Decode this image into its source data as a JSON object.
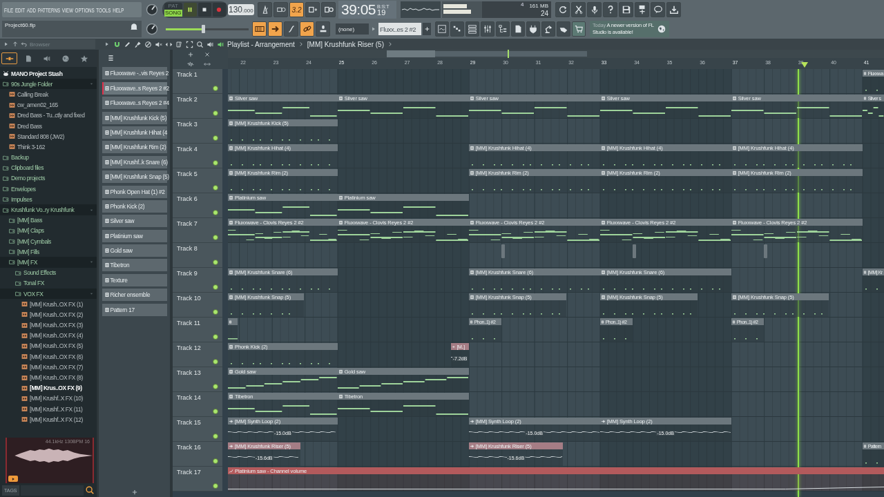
{
  "menu": [
    "FILE",
    "EDIT",
    "ADD",
    "PATTERNS",
    "VIEW",
    "OPTIONS",
    "TOOLS",
    "HELP"
  ],
  "project": {
    "file": "Project60.flp"
  },
  "transport": {
    "pat_label": "PAT",
    "song_label": "SONG",
    "song_selected": true,
    "playing": true,
    "tempo": "130",
    "tempo_decimals": ".000"
  },
  "mode_buttons": [
    {
      "on": false
    },
    {
      "on": false
    },
    {
      "label": "3.2",
      "on": true
    },
    {
      "on": false
    },
    {
      "on": false
    }
  ],
  "time": {
    "main": "39:05",
    "ticks": "19",
    "format": "B:S:T"
  },
  "monitor": {
    "cpu": "4",
    "memory": "161 MB",
    "polyphony": "24"
  },
  "master_volume": {
    "level": 0.45
  },
  "record_buttons": [
    {
      "on": true
    },
    {
      "on": true
    },
    {
      "on": false
    },
    {
      "on": true
    },
    {
      "on": false
    }
  ],
  "pattern_picker": {
    "snap": "(none)",
    "pattern": "Fluxx..es 2 #2"
  },
  "news": {
    "date": "Today",
    "text": "A newer version of FL Studio is available!"
  },
  "browser": {
    "title": "Browser",
    "tabs": [
      {
        "selected": true
      },
      {
        "selected": false
      },
      {
        "selected": false
      },
      {
        "selected": false
      },
      {
        "selected": false
      }
    ],
    "tree": [
      {
        "label": "MANO Project Stash",
        "kind": "pack",
        "selected": false
      },
      {
        "label": "90s Jungle Folder",
        "kind": "folder",
        "expanded": true,
        "selected": false,
        "children": [
          {
            "label": "Calling Break",
            "kind": "file",
            "selected": false
          },
          {
            "label": "cw_amen02_165",
            "kind": "file",
            "selected": false
          },
          {
            "label": "Dred Bass - Tu..ctly and fixed",
            "kind": "file",
            "selected": false
          },
          {
            "label": "Dred Bass",
            "kind": "file",
            "selected": false
          },
          {
            "label": "Standard 808 (JW2)",
            "kind": "file",
            "selected": false
          },
          {
            "label": "Think 3-162",
            "kind": "file",
            "selected": false
          }
        ]
      },
      {
        "label": "Backup",
        "kind": "folder",
        "expanded": false,
        "selected": false
      },
      {
        "label": "Clipboard files",
        "kind": "folder",
        "expanded": false,
        "selected": false
      },
      {
        "label": "Demo projects",
        "kind": "folder",
        "expanded": false,
        "selected": false
      },
      {
        "label": "Envelopes",
        "kind": "folder",
        "expanded": false,
        "selected": false
      },
      {
        "label": "Impulses",
        "kind": "folder",
        "expanded": false,
        "selected": false
      },
      {
        "label": "Krushfunk Vo..ry Krushfunk",
        "kind": "folder",
        "expanded": true,
        "selected": false,
        "children": [
          {
            "label": "[MM] Bass",
            "kind": "folder",
            "expanded": false,
            "selected": false
          },
          {
            "label": "[MM] Claps",
            "kind": "folder",
            "expanded": false,
            "selected": false
          },
          {
            "label": "[MM] Cymbals",
            "kind": "folder",
            "expanded": false,
            "selected": false
          },
          {
            "label": "[MM] Fills",
            "kind": "folder",
            "expanded": false,
            "selected": false
          },
          {
            "label": "[MM] FX",
            "kind": "folder",
            "expanded": true,
            "selected": false,
            "children": [
              {
                "label": "Sound Effects",
                "kind": "folder",
                "expanded": false,
                "selected": false
              },
              {
                "label": "Tonal FX",
                "kind": "folder",
                "expanded": false,
                "selected": false
              },
              {
                "label": "VOX FX",
                "kind": "folder",
                "expanded": true,
                "selected": false,
                "children": [
                  {
                    "label": "[MM] Krush..OX FX (1)",
                    "kind": "file",
                    "selected": false
                  },
                  {
                    "label": "[MM] Krush..OX FX (2)",
                    "kind": "file",
                    "selected": false
                  },
                  {
                    "label": "[MM] Krush..OX FX (3)",
                    "kind": "file",
                    "selected": false
                  },
                  {
                    "label": "[MM] Krush..OX FX (4)",
                    "kind": "file",
                    "selected": false
                  },
                  {
                    "label": "[MM] Krush..OX FX (5)",
                    "kind": "file",
                    "selected": false
                  },
                  {
                    "label": "[MM] Krush..OX FX (6)",
                    "kind": "file",
                    "selected": false
                  },
                  {
                    "label": "[MM] Krush..OX FX (7)",
                    "kind": "file",
                    "selected": false
                  },
                  {
                    "label": "[MM] Krush..OX FX (8)",
                    "kind": "file",
                    "selected": false
                  },
                  {
                    "label": "[MM] Krus..OX FX (9)",
                    "kind": "file",
                    "selected": true
                  },
                  {
                    "label": "[MM] Krushf..X FX (10)",
                    "kind": "file",
                    "selected": false
                  },
                  {
                    "label": "[MM] Krushf..X FX (11)",
                    "kind": "file",
                    "selected": false
                  },
                  {
                    "label": "[MM] Krushf..X FX (12)",
                    "kind": "file",
                    "selected": false
                  }
                ]
              }
            ]
          }
        ]
      }
    ],
    "preview": {
      "info": "44.1kHz 130BPM 16"
    },
    "tags_label": "TAGS"
  },
  "patterns": [
    {
      "label": "Fluxxwave -..vis Reyes 2",
      "selected": false
    },
    {
      "label": "Fluxxwave..s Reyes 2 #2",
      "selected": true
    },
    {
      "label": "Fluxxwave..s Reyes 2 #4",
      "selected": false
    },
    {
      "label": "[MM] Krushfunk Kick (5)",
      "selected": false
    },
    {
      "label": "[MM] Krushfunk Hihat (4",
      "selected": false
    },
    {
      "label": "[MM] Krushfunk Rim (2)",
      "selected": false
    },
    {
      "label": "[MM] Krushf..k Snare (6)",
      "selected": false
    },
    {
      "label": "[MM] Krushfunk Snap (5)",
      "selected": false
    },
    {
      "label": "Phonk Open Hat (1) #2",
      "selected": false
    },
    {
      "label": "Phonk Kick (2)",
      "selected": false
    },
    {
      "label": "Silver saw",
      "selected": false
    },
    {
      "label": "Platinium saw",
      "selected": false
    },
    {
      "label": "Gold saw",
      "selected": false
    },
    {
      "label": "Tibetron",
      "selected": false
    },
    {
      "label": "Texture",
      "selected": false
    },
    {
      "label": "Richer ensemble",
      "selected": false
    },
    {
      "label": "Pattern 17",
      "selected": false
    }
  ],
  "playlist": {
    "title": "Playlist - Arrangement",
    "pattern": "[MM] Krushfunk Riser (5)",
    "bars": [
      "22",
      "23",
      "24",
      "25",
      "26",
      "27",
      "28",
      "29",
      "30",
      "31",
      "32",
      "33",
      "34",
      "35",
      "36",
      "37",
      "38",
      "39",
      "40",
      "41"
    ],
    "tracks": [
      {
        "name": "Track 1",
        "enabled": true,
        "clips": [
          {
            "kind": "pattern",
            "label": "Fluxxwa",
            "color": "#6c777d"
          }
        ]
      },
      {
        "name": "Track 2",
        "enabled": true,
        "clips": [
          {
            "kind": "pattern",
            "label": "Silver saw",
            "color": "#6c777d"
          },
          {
            "kind": "pattern",
            "label": "Silver saw",
            "color": "#6c777d"
          },
          {
            "kind": "pattern",
            "label": "Silver saw",
            "color": "#6c777d"
          },
          {
            "kind": "pattern",
            "label": "Silver saw",
            "color": "#6c777d"
          },
          {
            "kind": "pattern",
            "label": "Silver saw",
            "color": "#6c777d"
          },
          {
            "kind": "pattern",
            "label": "Silver s",
            "color": "#6c777d"
          }
        ]
      },
      {
        "name": "Track 3",
        "enabled": true,
        "clips": [
          {
            "kind": "pattern",
            "label": "[MM] Krushfunk Kick (5)",
            "color": "#6c777d"
          }
        ]
      },
      {
        "name": "Track 4",
        "enabled": true,
        "clips": [
          {
            "kind": "pattern",
            "label": "[MM] Krushfunk Hihat (4)",
            "color": "#6c777d"
          },
          {
            "kind": "pattern",
            "label": "[MM] Krushfunk Hihat (4)",
            "color": "#6c777d"
          },
          {
            "kind": "pattern",
            "label": "[MM] Krushfunk Hihat (4)",
            "color": "#6c777d"
          },
          {
            "kind": "pattern",
            "label": "[MM] Krushfunk Hihat (4)",
            "color": "#6c777d"
          }
        ]
      },
      {
        "name": "Track 5",
        "enabled": true,
        "clips": [
          {
            "kind": "pattern",
            "label": "[MM] Krushfunk Rim (2)",
            "color": "#6c777d"
          },
          {
            "kind": "pattern",
            "label": "[MM] Krushfunk Rim (2)",
            "color": "#6c777d"
          },
          {
            "kind": "pattern",
            "label": "[MM] Krushfunk Rim (2)",
            "color": "#6c777d"
          },
          {
            "kind": "pattern",
            "label": "[MM] Krushfunk Rim (2)",
            "color": "#6c777d"
          }
        ]
      },
      {
        "name": "Track 6",
        "enabled": true,
        "clips": [
          {
            "kind": "pattern",
            "label": "Platinium saw",
            "color": "#6c777d"
          },
          {
            "kind": "pattern",
            "label": "Platinium saw",
            "color": "#6c777d"
          }
        ]
      },
      {
        "name": "Track 7",
        "enabled": true,
        "clips": [
          {
            "kind": "pattern",
            "label": "Fluxxwave - Clovis Reyes 2 #2",
            "color": "#6c777d"
          },
          {
            "kind": "pattern",
            "label": "Fluxxwave - Clovis Reyes 2 #2",
            "color": "#6c777d"
          },
          {
            "kind": "pattern",
            "label": "Fluxxwave - Clovis Reyes 2 #2",
            "color": "#6c777d"
          },
          {
            "kind": "pattern",
            "label": "Fluxxwave - Clovis Reyes 2 #2",
            "color": "#6c777d"
          },
          {
            "kind": "pattern",
            "label": "Fluxxwave - Clovis Reyes 2 #2",
            "color": "#6c777d"
          }
        ]
      },
      {
        "name": "Track 8",
        "enabled": true,
        "clips": [
          {
            "kind": "stub",
            "color": "#6c777d"
          },
          {
            "kind": "stub",
            "color": "#6c777d"
          },
          {
            "kind": "stub",
            "color": "#6c777d"
          }
        ]
      },
      {
        "name": "Track 9",
        "enabled": true,
        "clips": [
          {
            "kind": "pattern",
            "label": "[MM] Krushfunk Snare (6)",
            "color": "#6c777d"
          },
          {
            "kind": "pattern",
            "label": "[MM] Krushfunk Snare (6)",
            "color": "#6c777d"
          },
          {
            "kind": "pattern",
            "label": "[MM] Krushfunk Snare (6)",
            "color": "#6c777d"
          },
          {
            "kind": "pattern",
            "label": "[MM] Kr",
            "color": "#6c777d"
          }
        ]
      },
      {
        "name": "Track 10",
        "enabled": true,
        "clips": [
          {
            "kind": "pattern",
            "label": "[MM] Krushfunk Snap (5)",
            "color": "#6c777d"
          },
          {
            "kind": "pattern",
            "label": "[MM] Krushfunk Snap (5)",
            "color": "#6c777d"
          },
          {
            "kind": "pattern",
            "label": "[MM] Krushfunk Snap (5)",
            "color": "#6c777d"
          },
          {
            "kind": "pattern",
            "label": "[MM] Krushfunk Snap (5)",
            "color": "#6c777d"
          }
        ]
      },
      {
        "name": "Track 11",
        "enabled": true,
        "clips": [
          {
            "kind": "pattern",
            "color": "#6c777d"
          },
          {
            "kind": "pattern",
            "label": "Phon..1) #2",
            "color": "#6c777d"
          },
          {
            "kind": "pattern",
            "label": "Phon..1) #2",
            "color": "#6c777d"
          },
          {
            "kind": "pattern",
            "label": "Phon..1) #2",
            "color": "#6c777d"
          }
        ]
      },
      {
        "name": "Track 12",
        "enabled": true,
        "clips": [
          {
            "kind": "pattern",
            "label": "Phonk Kick (2)",
            "color": "#6c777d"
          },
          {
            "kind": "audio",
            "label": "[M..]",
            "gain": "-7.2dB",
            "color": "#a57d85"
          }
        ]
      },
      {
        "name": "Track 13",
        "enabled": true,
        "clips": [
          {
            "kind": "pattern",
            "label": "Gold saw",
            "color": "#6c777d"
          },
          {
            "kind": "pattern",
            "label": "Gold saw",
            "color": "#6c777d"
          }
        ]
      },
      {
        "name": "Track 14",
        "enabled": true,
        "clips": [
          {
            "kind": "pattern",
            "label": "Tibetron",
            "color": "#6c777d"
          },
          {
            "kind": "pattern",
            "label": "Tibetron",
            "color": "#6c777d"
          }
        ]
      },
      {
        "name": "Track 15",
        "enabled": true,
        "clips": [
          {
            "kind": "audio",
            "label": "[MM] Synth Loop (2)",
            "gain": "-15.0dB",
            "color": "#6c777d"
          },
          {
            "kind": "audio",
            "label": "[MM] Synth Loop (2)",
            "gain": "-15.0dB",
            "color": "#6c777d"
          },
          {
            "kind": "audio",
            "label": "[MM] Synth Loop (2)",
            "gain": "-15.0dB",
            "color": "#6c777d"
          }
        ]
      },
      {
        "name": "Track 16",
        "enabled": true,
        "clips": [
          {
            "kind": "audio",
            "label": "[MM] Krushfunk Riser (5)",
            "gain": "-15.6dB",
            "color": "#a57d85"
          },
          {
            "kind": "audio",
            "label": "[MM] Krushfunk Riser (5)",
            "gain": "-15.6dB",
            "color": "#a57d85"
          },
          {
            "kind": "pattern",
            "label": "Pattern",
            "color": "#6c777d"
          }
        ]
      },
      {
        "name": "Track 17",
        "enabled": true,
        "clips": [
          {
            "kind": "automation",
            "label": "Platinium saw - Channel volume",
            "color": "#b35a5c"
          }
        ]
      }
    ]
  }
}
